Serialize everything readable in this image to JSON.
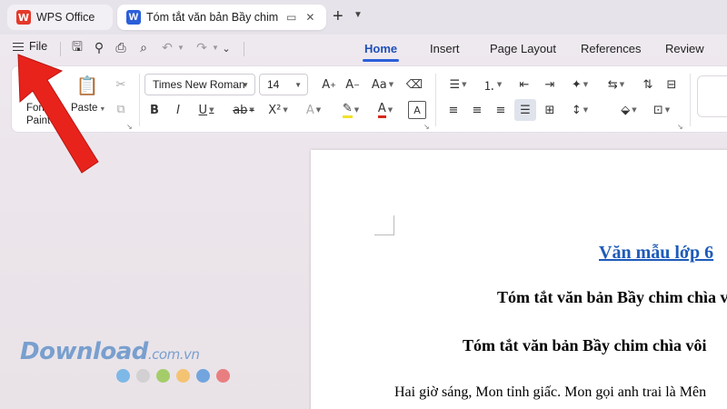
{
  "tabs": {
    "app_title": "WPS Office",
    "doc_title": "Tóm tắt văn bản Bầy chim chìa vôi",
    "new_tab": "+",
    "new_tab_menu": "⌄"
  },
  "menu": {
    "file_label": "File"
  },
  "ribbon_tabs": [
    "Home",
    "Insert",
    "Page Layout",
    "References",
    "Review"
  ],
  "ribbon": {
    "format_painter_label": "Format Painter",
    "format_painter_visible": "Form\nPainte",
    "paste_label": "Paste",
    "font_name": "Times New Roman",
    "font_size": "14"
  },
  "document": {
    "title": "Văn mẫu lớp 6",
    "title_visible": "Văn mẫu lớp 6",
    "heading1": "Tóm tắt văn bản Bầy chim chìa vôi",
    "heading2": "Tóm tắt văn bản Bầy chim chìa vôi",
    "paragraph": "Hai giờ sáng, Mon tỉnh giấc. Mon gọi anh trai là Mên"
  },
  "watermark": {
    "brand": "Download",
    "suffix": ".com.vn",
    "dot_colors": [
      "#5aa9e6",
      "#c9c9c9",
      "#8cc63f",
      "#f7b84b",
      "#4a90d9",
      "#e85c5c"
    ]
  },
  "colors": {
    "accent": "#2b5fd9",
    "arrow": "#e8231c",
    "doc_title": "#1e5bb8"
  },
  "icons": {
    "menu": "hamburger-icon",
    "save": "save-icon",
    "print": "print-icon",
    "undo": "undo-icon",
    "redo": "redo-icon",
    "cut": "cut-icon",
    "bold": "bold-icon",
    "italic": "italic-icon",
    "underline": "underline-icon"
  }
}
